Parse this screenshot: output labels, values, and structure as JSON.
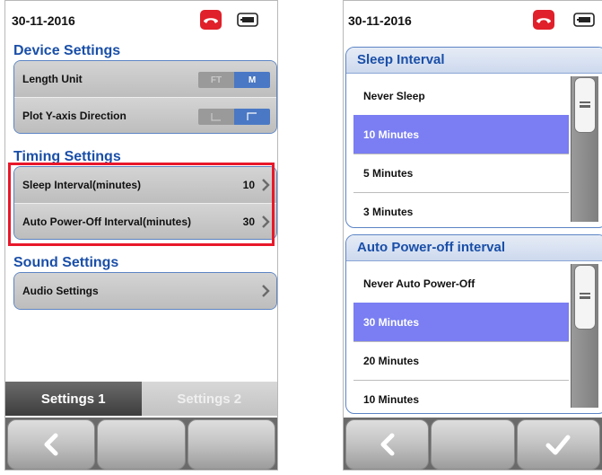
{
  "left": {
    "date": "30-11-2016",
    "device_settings": {
      "title": "Device Settings",
      "length_unit": {
        "label": "Length Unit",
        "options": [
          "FT",
          "M"
        ],
        "selected": "M"
      },
      "plot_direction": {
        "label": "Plot Y-axis Direction",
        "selected": "up"
      }
    },
    "timing_settings": {
      "title": "Timing Settings",
      "sleep": {
        "label": "Sleep Interval(minutes)",
        "value": "10"
      },
      "auto_off": {
        "label": "Auto Power-Off Interval(minutes)",
        "value": "30"
      }
    },
    "sound_settings": {
      "title": "Sound Settings",
      "audio": {
        "label": "Audio Settings"
      }
    },
    "tabs": [
      "Settings 1",
      "Settings 2"
    ],
    "active_tab": "Settings 1"
  },
  "right": {
    "date": "30-11-2016",
    "sleep_panel": {
      "title": "Sleep Interval",
      "options": [
        "Never Sleep",
        "10 Minutes",
        "5 Minutes",
        "3 Minutes"
      ],
      "selected": "10 Minutes"
    },
    "auto_off_panel": {
      "title": "Auto Power-off interval",
      "options": [
        "Never Auto Power-Off",
        "30 Minutes",
        "20 Minutes",
        "10 Minutes"
      ],
      "selected": "30 Minutes"
    }
  },
  "colors": {
    "accent": "#1a4fa8",
    "selection": "#7a7ef2",
    "highlight": "#e8182a",
    "phone": "#e0202a"
  },
  "icons": [
    "phone-icon",
    "battery-icon",
    "chevron-right-icon",
    "back-icon",
    "check-icon",
    "scroll-grip-icon"
  ]
}
